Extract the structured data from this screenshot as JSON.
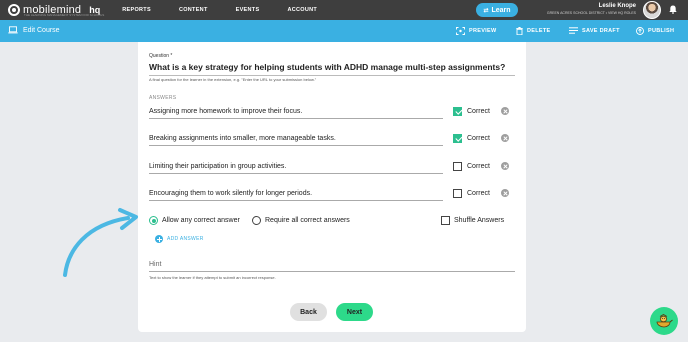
{
  "topbar": {
    "logo_text": "mobilemind",
    "logo_sub": "THE LEARNING MANAGEMENT SYSTEM FOR SCHOOLS",
    "hq": "hq",
    "nav": [
      "REPORTS",
      "CONTENT",
      "EVENTS",
      "ACCOUNT"
    ],
    "learn_label": "Learn",
    "learn_icon": "shuffle-icon",
    "user_name": "Leslie Knope",
    "user_org": "GREEN ACRES SCHOOL DISTRICT • VIEW HQ ROLES",
    "bell_icon": "bell-icon"
  },
  "actionbar": {
    "title": "Edit Course",
    "actions": {
      "preview": "PREVIEW",
      "delete": "DELETE",
      "save_draft": "SAVE DRAFT",
      "publish": "PUBLISH"
    }
  },
  "question": {
    "label": "Question *",
    "text": "What is a key strategy for helping students with ADHD manage multi-step assignments?",
    "help": "A final question for the learner in the extension, e.g. \"Enter the URL to your submission below.\""
  },
  "answers_label": "ANSWERS",
  "correct_label": "Correct",
  "answers": [
    {
      "text": "Assigning more homework to improve their focus.",
      "correct": true
    },
    {
      "text": "Breaking assignments into smaller, more manageable tasks.",
      "correct": true
    },
    {
      "text": "Limiting their participation in group activities.",
      "correct": false
    },
    {
      "text": "Encouraging them to work silently for longer periods.",
      "correct": false
    }
  ],
  "options": {
    "allow_any": "Allow any correct answer",
    "require_all": "Require all correct answers",
    "shuffle": "Shuffle Answers",
    "selected": "allow_any",
    "shuffle_checked": false
  },
  "add_answer": "ADD ANSWER",
  "hint": {
    "placeholder": "Hint",
    "help": "Text to show the learner if they attempt to submit an incorrect response."
  },
  "buttons": {
    "back": "Back",
    "next": "Next"
  },
  "colors": {
    "topbar": "#3e3e3e",
    "accent_blue": "#3ab0e2",
    "check_green": "#2cbf8f",
    "next_green": "#2dd98a"
  }
}
